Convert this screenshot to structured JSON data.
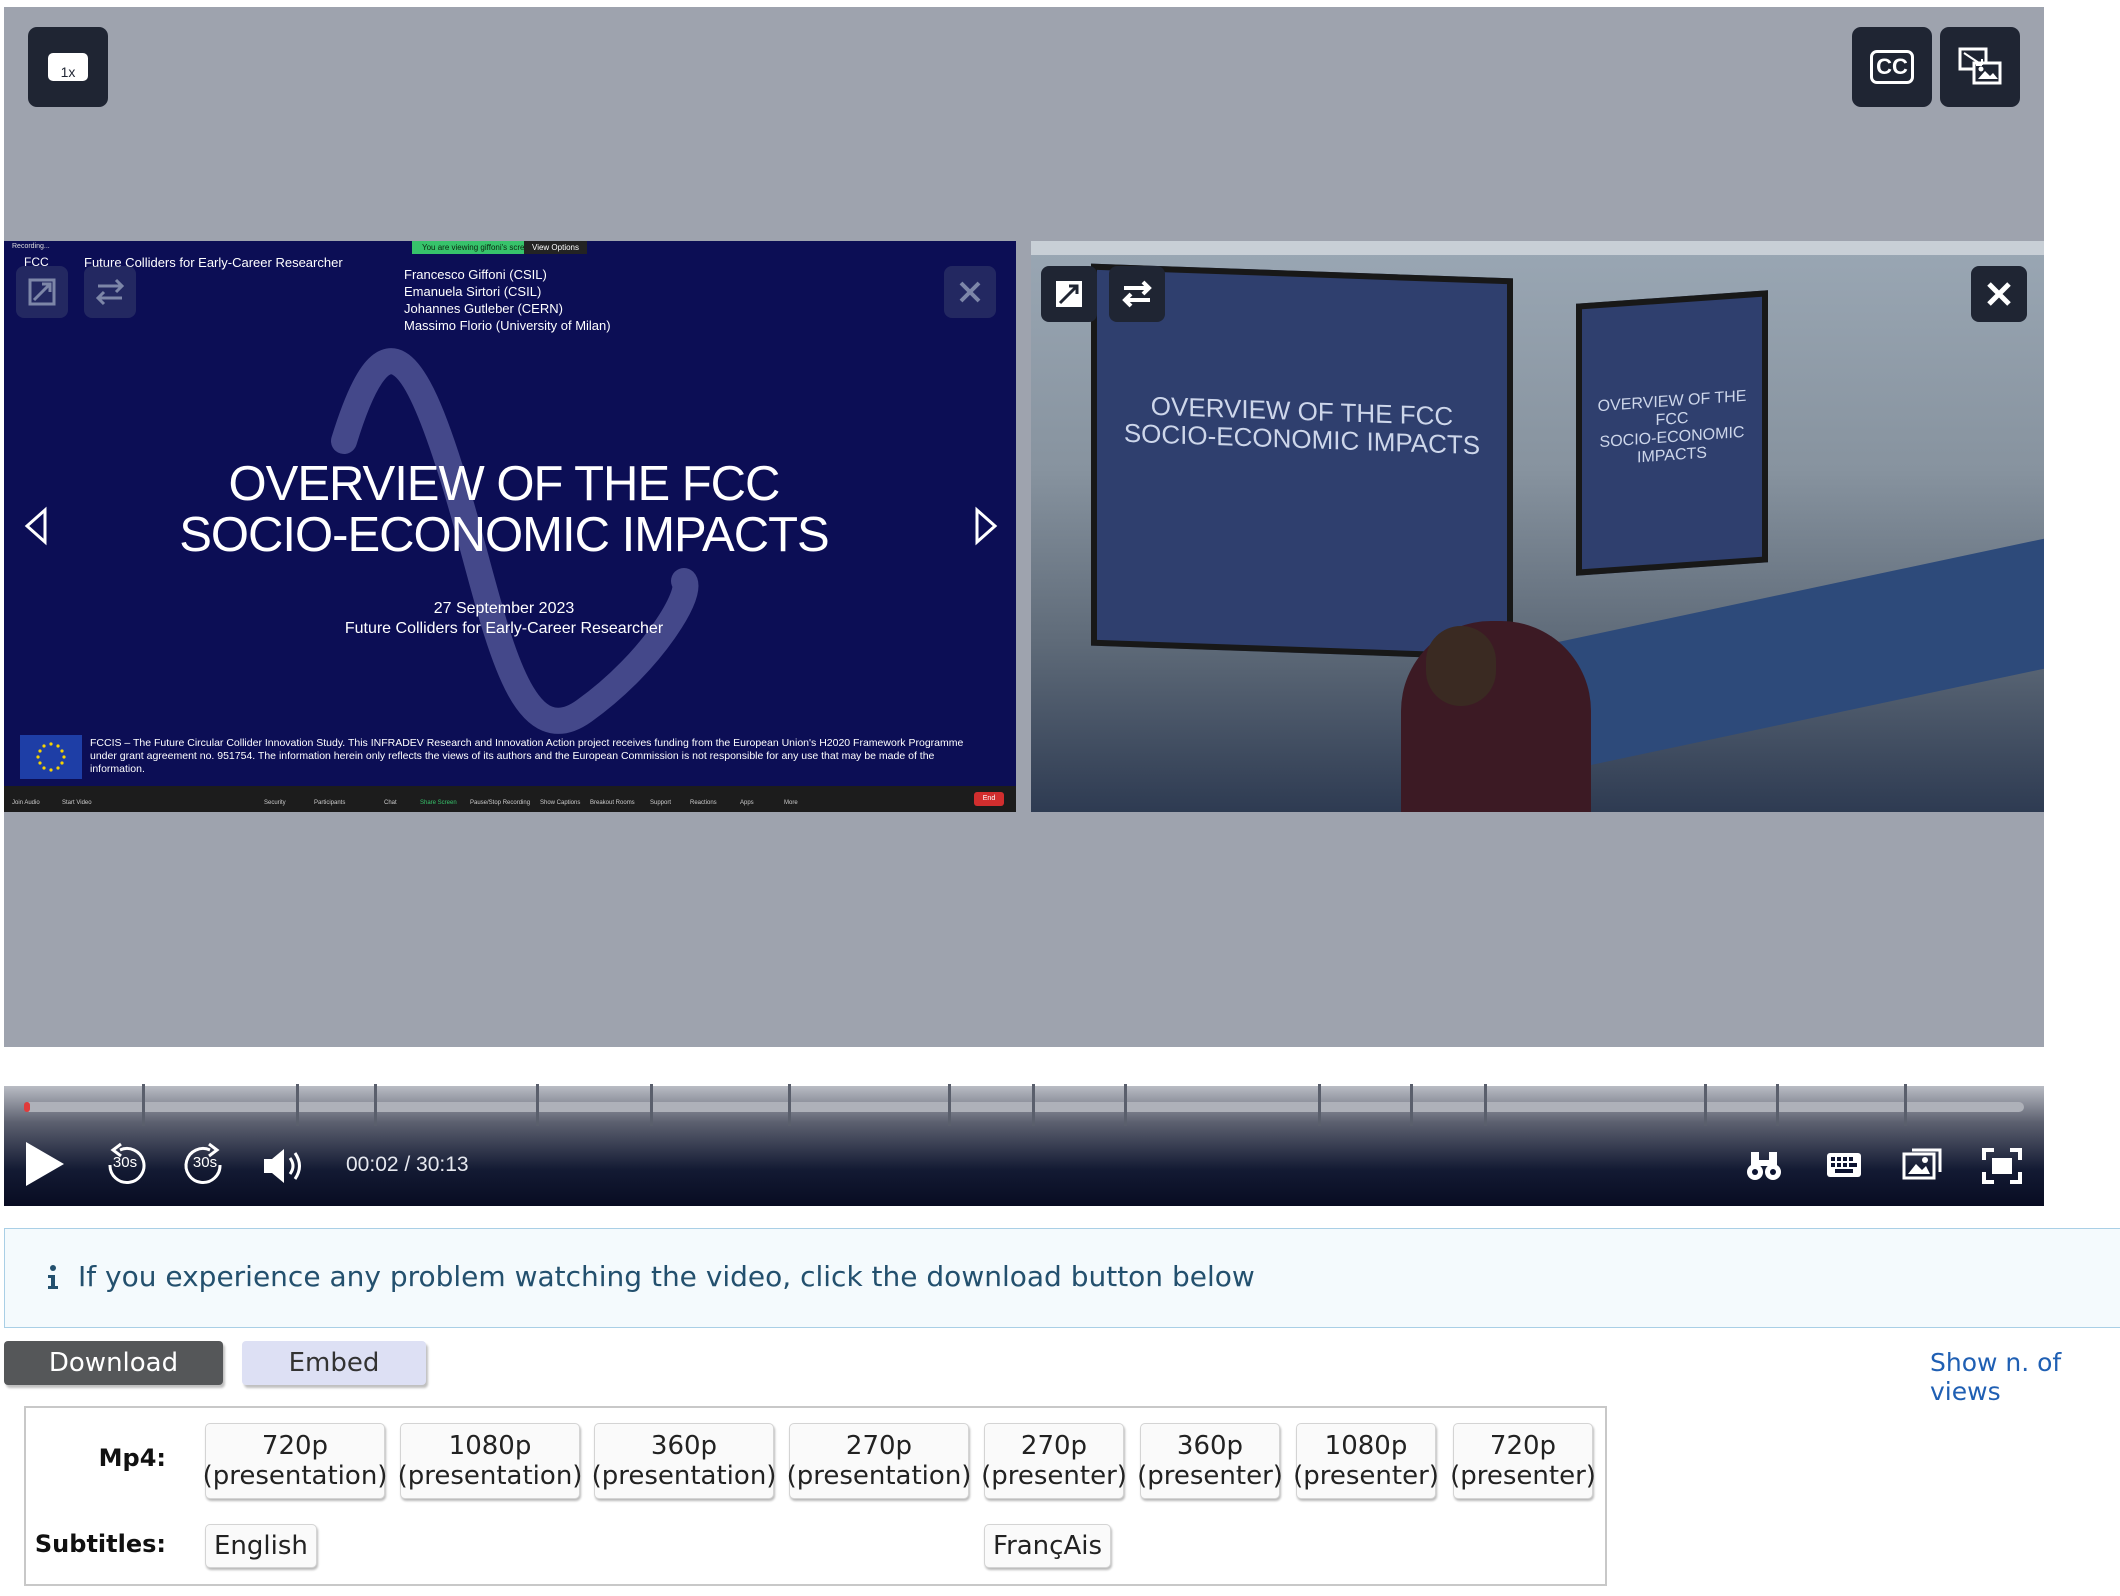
{
  "player": {
    "speed_label": "1x",
    "cc_label": "CC",
    "time": "00:02 / 30:13",
    "rewind_label": "30s",
    "forward_label": "30s",
    "progress_fraction": 0.001,
    "chapter_marks": [
      0.059,
      0.136,
      0.175,
      0.256,
      0.313,
      0.382,
      0.462,
      0.504,
      0.55,
      0.647,
      0.693,
      0.73,
      0.84,
      0.876,
      0.94
    ]
  },
  "slide": {
    "header": "Future Colliders for Early-Career Researcher",
    "logo": "FCC",
    "recording": "Recording...",
    "zoom_status": "You are viewing giffoni's screen",
    "zoom_view": "View Options",
    "authors": [
      "Francesco Giffoni (CSIL)",
      "Emanuela Sirtori (CSIL)",
      "Johannes Gutleber (CERN)",
      "Massimo Florio (University of Milan)"
    ],
    "title_line1": "OVERVIEW OF THE FCC",
    "title_line2": "SOCIO-ECONOMIC IMPACTS",
    "date": "27 September 2023",
    "subtitle": "Future Colliders for Early-Career Researcher",
    "funding": "FCCIS – The Future Circular Collider Innovation Study. This INFRADEV Research and Innovation Action project receives funding from the European Union's H2020 Framework Programme under grant agreement no. 951754. The information herein only reflects the views of its authors and the European Commission is not responsible for any use that may be made of the information.",
    "toolbar_items": [
      "Join Audio",
      "Start Video",
      "Security",
      "Participants",
      "Chat",
      "Share Screen",
      "Pause/Stop Recording",
      "Show Captions",
      "Breakout Rooms",
      "Support",
      "Reactions",
      "Apps",
      "More"
    ],
    "end_label": "End"
  },
  "camera": {
    "screen1_line1": "OVERVIEW OF THE FCC",
    "screen1_line2": "SOCIO-ECONOMIC IMPACTS",
    "screen2_line1": "OVERVIEW OF THE FCC",
    "screen2_line2": "SOCIO-ECONOMIC IMPACTS"
  },
  "alert": {
    "text": "If you experience any problem watching the video, click the download button below"
  },
  "tabs": {
    "download": "Download",
    "embed": "Embed",
    "views": "Show n. of views"
  },
  "downloads": {
    "mp4_label": "Mp4:",
    "subtitles_label": "Subtitles:",
    "mp4": [
      {
        "res": "720p",
        "kind": "(presentation)"
      },
      {
        "res": "1080p",
        "kind": "(presentation)"
      },
      {
        "res": "360p",
        "kind": "(presentation)"
      },
      {
        "res": "270p",
        "kind": "(presentation)"
      },
      {
        "res": "270p",
        "kind": "(presenter)"
      },
      {
        "res": "360p",
        "kind": "(presenter)"
      },
      {
        "res": "1080p",
        "kind": "(presenter)"
      },
      {
        "res": "720p",
        "kind": "(presenter)"
      }
    ],
    "subtitles": [
      "English",
      "FrançAis"
    ]
  },
  "colors": {
    "slide_bg": "#0c0e55",
    "stage_bg": "#9ea3ae",
    "accent_link": "#1f5fb3",
    "alert_text": "#23506e"
  }
}
